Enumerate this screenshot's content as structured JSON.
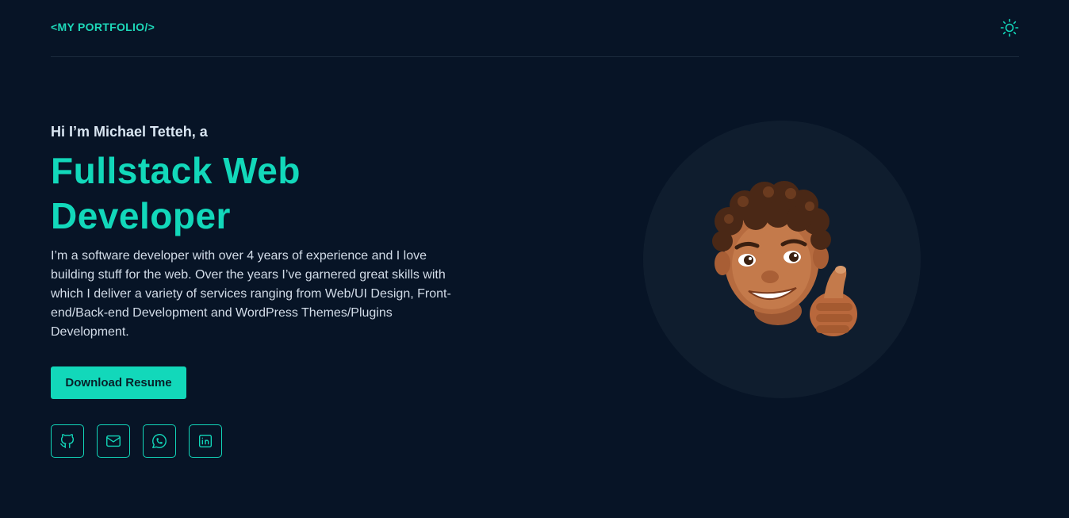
{
  "header": {
    "logo": "<MY PORTFOLIO/>",
    "theme_icon": "sun-icon"
  },
  "hero": {
    "greeting": "Hi I’m Michael Tetteh, a",
    "title_line1": "Fullstack Web",
    "title_line2": "Developer",
    "bio": "I’m a software developer with over 4 years of experience and I love building stuff for the web. Over the years I’ve garnered great skills with which I deliver a variety of services ranging from Web/UI Design, Front-end/Back-end Development and WordPress Themes/Plugins Development.",
    "resume_button": "Download Resume",
    "socials": [
      "github-icon",
      "mail-icon",
      "whatsapp-icon",
      "linkedin-icon"
    ],
    "avatar_icon": "memoji-thumbs-up-avatar"
  },
  "colors": {
    "background": "#071426",
    "accent": "#12d8ba",
    "text": "#d2dce8",
    "avatar_bg": "#0f1d2e"
  }
}
